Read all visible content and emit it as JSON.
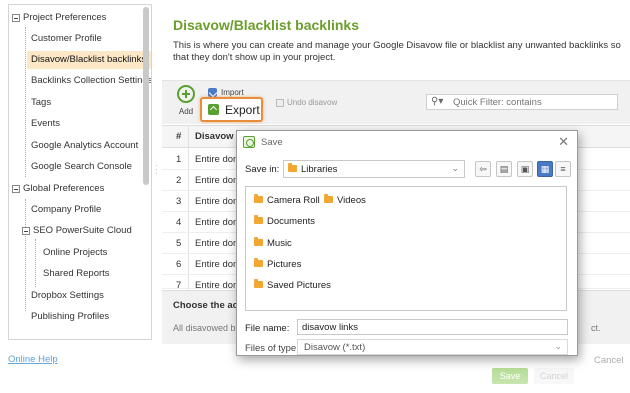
{
  "sidebar": {
    "project_preferences": "Project Preferences",
    "project_items": [
      "Customer Profile",
      "Disavow/Blacklist backlinks",
      "Backlinks Collection Settings",
      "Tags",
      "Events",
      "Google Analytics Account",
      "Google Search Console"
    ],
    "global_preferences": "Global Preferences",
    "global_items": [
      "Company Profile"
    ],
    "cloud_label": "SEO PowerSuite Cloud",
    "cloud_items": [
      "Online Projects",
      "Shared Reports"
    ],
    "more_items": [
      "Dropbox Settings",
      "Publishing Profiles"
    ]
  },
  "footer": {
    "online_help": "Online Help",
    "cancel": "Cancel"
  },
  "main": {
    "title": "Disavow/Blacklist backlinks",
    "description": "This is where you can create and manage your Google Disavow file or blacklist any unwanted backlinks so that they don't show up in your project."
  },
  "toolbar": {
    "add": "Add",
    "import": "Import",
    "export": "Export",
    "undo": "Undo disavow",
    "filter_placeholder": "Quick Filter: contains"
  },
  "table": {
    "col_num": "#",
    "col_disavow": "Disavow m",
    "rows": [
      {
        "num": "1",
        "text": "Entire dom"
      },
      {
        "num": "2",
        "text": "Entire dom"
      },
      {
        "num": "3",
        "text": "Entire dom"
      },
      {
        "num": "4",
        "text": "Entire dom"
      },
      {
        "num": "5",
        "text": "Entire dom"
      },
      {
        "num": "6",
        "text": "Entire dom"
      },
      {
        "num": "7",
        "text": "Entire dom"
      }
    ]
  },
  "choose": {
    "title": "Choose the acti",
    "text_start": "All disavowed ba",
    "text_end": "ct."
  },
  "buttons": {
    "save": "Save",
    "cancel": "Cancel"
  },
  "dialog": {
    "title": "Save",
    "save_in_label": "Save in:",
    "save_in_value": "Libraries",
    "items": [
      "Camera Roll",
      "Videos",
      "Documents",
      "Music",
      "Pictures",
      "Saved Pictures"
    ],
    "file_name_label": "File name:",
    "file_name_value": "disavow links",
    "file_type_label": "Files of type:",
    "file_type_value": "Disavow (*.txt)"
  }
}
